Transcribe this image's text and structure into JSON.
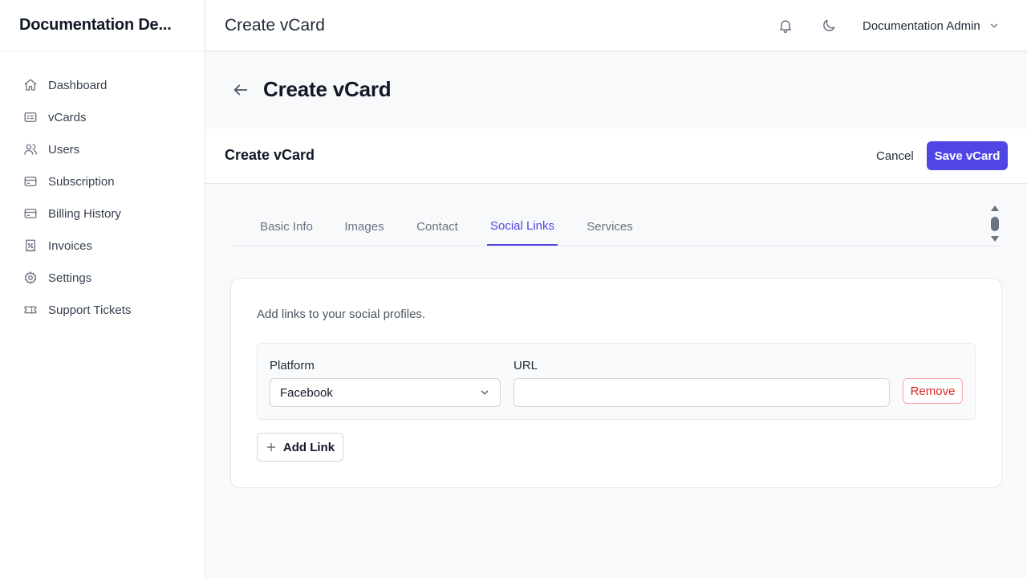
{
  "sidebar": {
    "brand": "Documentation De...",
    "items": [
      {
        "label": "Dashboard",
        "icon": "home-icon"
      },
      {
        "label": "vCards",
        "icon": "id-card-icon"
      },
      {
        "label": "Users",
        "icon": "users-icon"
      },
      {
        "label": "Subscription",
        "icon": "credit-card-icon"
      },
      {
        "label": "Billing History",
        "icon": "credit-card-icon"
      },
      {
        "label": "Invoices",
        "icon": "receipt-icon"
      },
      {
        "label": "Settings",
        "icon": "gear-icon"
      },
      {
        "label": "Support Tickets",
        "icon": "ticket-icon"
      }
    ]
  },
  "topbar": {
    "title": "Create vCard",
    "icons": [
      "bell-icon",
      "moon-icon"
    ],
    "user_name": "Documentation Admin"
  },
  "page": {
    "title": "Create vCard"
  },
  "card": {
    "title": "Create vCard",
    "cancel_label": "Cancel",
    "save_label": "Save vCard"
  },
  "tabs": [
    {
      "label": "Basic Info",
      "active": false
    },
    {
      "label": "Images",
      "active": false
    },
    {
      "label": "Contact",
      "active": false
    },
    {
      "label": "Social Links",
      "active": true
    },
    {
      "label": "Services",
      "active": false
    }
  ],
  "social": {
    "helper": "Add links to your social profiles.",
    "platform_label": "Platform",
    "platform_value": "Facebook",
    "url_label": "URL",
    "url_value": "",
    "remove_label": "Remove",
    "add_label": "Add Link"
  },
  "colors": {
    "accent": "#4f46e5",
    "danger": "#dc2626"
  }
}
